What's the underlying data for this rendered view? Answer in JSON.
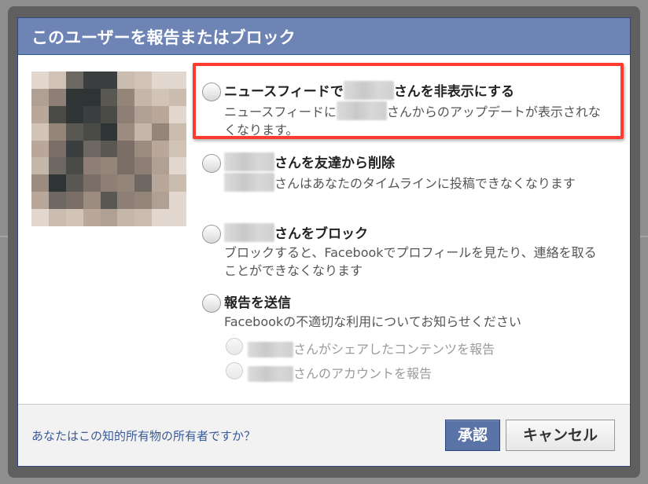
{
  "dialog": {
    "title": "このユーザーを報告またはブロック",
    "options": [
      {
        "title_before": "ニュースフィードで",
        "title_after": "さんを非表示にする",
        "desc_before": "ニュースフィードに",
        "desc_after": "さんからのアップデートが表示されなくなります。"
      },
      {
        "title_after": "さんを友達から削除",
        "desc_after": "さんはあなたのタイムラインに投稿できなくなります"
      },
      {
        "title_after": "さんをブロック",
        "desc": "ブロックすると、Facebookでプロフィールを見たり、連絡を取ることができなくなります"
      },
      {
        "title": "報告を送信",
        "desc": "Facebookの不適切な利用についてお知らせください",
        "sub_options": [
          "さんがシェアしたコンテンツを報告",
          "さんのアカウントを報告"
        ]
      }
    ],
    "footer": {
      "link": "あなたはこの知的所有物の所有者ですか？",
      "confirm_label": "承認",
      "cancel_label": "キャンセル"
    }
  },
  "colors": {
    "header_bg": "#6d84b4",
    "highlight_border": "#ff3b2f",
    "confirm_bg": "#5b74a8",
    "link": "#3b5998"
  }
}
